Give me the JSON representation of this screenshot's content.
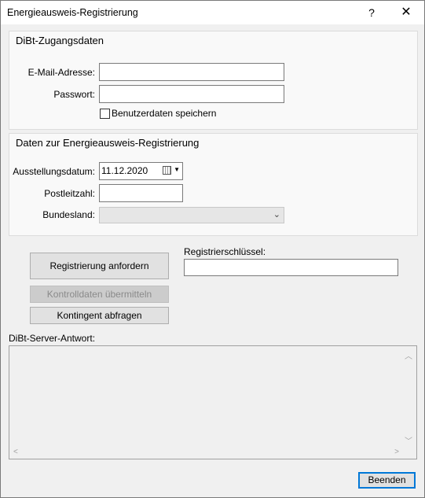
{
  "window": {
    "title": "Energieausweis-Registrierung",
    "help_glyph": "?",
    "close_glyph": "✕"
  },
  "credentials": {
    "title": "DiBt-Zugangsdaten",
    "email_label": "E-Mail-Adresse:",
    "email_value": "",
    "password_label": "Passwort:",
    "password_value": "",
    "save_label": "Benutzerdaten speichern",
    "save_checked": false
  },
  "registration": {
    "title": "Daten zur Energieausweis-Registrierung",
    "date_label": "Ausstellungsdatum:",
    "date_value": "11.12.2020",
    "zip_label": "Postleitzahl:",
    "zip_value": "",
    "state_label": "Bundesland:",
    "state_value": ""
  },
  "actions": {
    "request_label": "Registrierung anfordern",
    "transmit_label": "Kontrolldaten übermitteln",
    "quota_label": "Kontingent abfragen",
    "key_label": "Registrierschlüssel:",
    "key_value": ""
  },
  "response": {
    "label": "DiBt-Server-Antwort:",
    "text": ""
  },
  "footer": {
    "close_label": "Beenden"
  },
  "icons": {
    "calendar": "calendar-icon",
    "dropdown": "chevron-down-icon"
  }
}
